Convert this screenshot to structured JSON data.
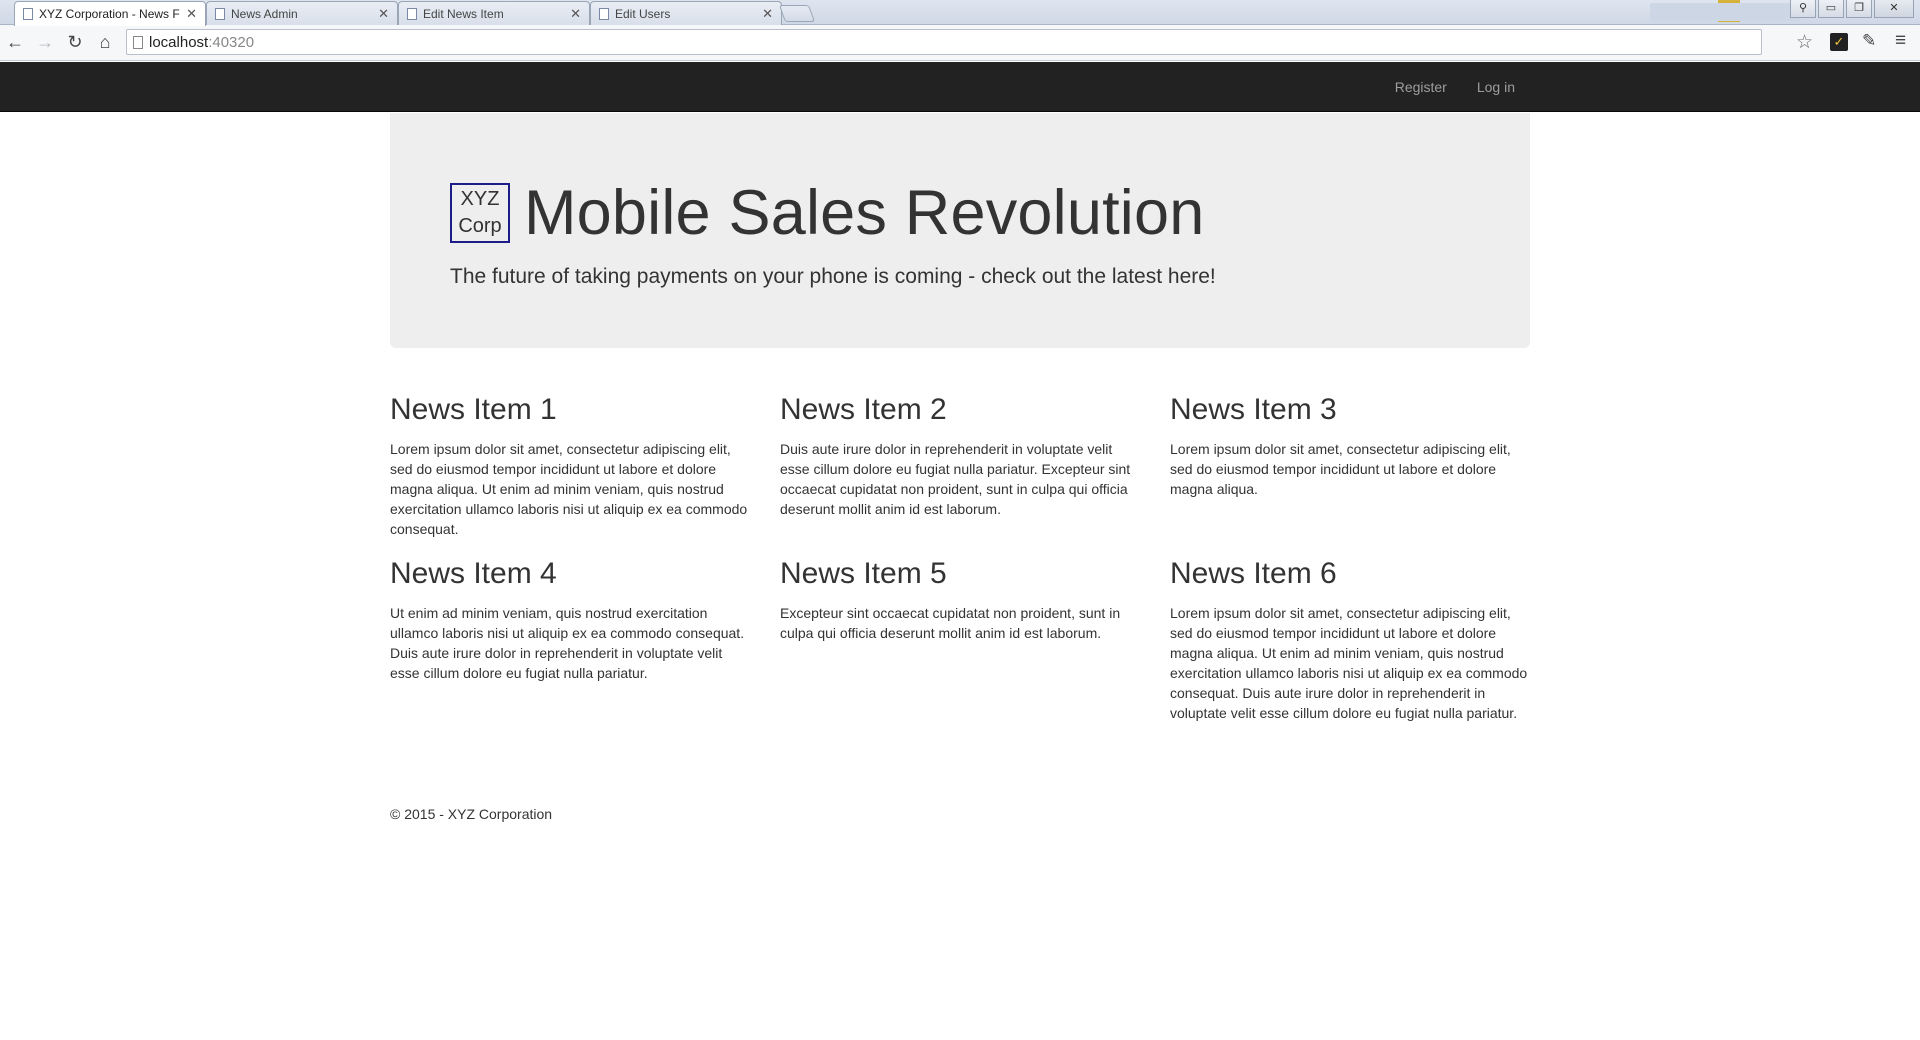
{
  "browser": {
    "tabs": [
      {
        "label": "XYZ Corporation - News F",
        "active": true
      },
      {
        "label": "News Admin",
        "active": false
      },
      {
        "label": "Edit News Item",
        "active": false
      },
      {
        "label": "Edit Users",
        "active": false
      }
    ],
    "url_host": "localhost",
    "url_port": ":40320"
  },
  "navbar": {
    "register_label": "Register",
    "login_label": "Log in"
  },
  "jumbotron": {
    "logo_line1": "XYZ",
    "logo_line2": "Corp",
    "title": "Mobile Sales Revolution",
    "lead": "The future of taking payments on your phone is coming - check out the latest here!"
  },
  "news": [
    {
      "title": "News Item 1",
      "body": "Lorem ipsum dolor sit amet, consectetur adipiscing elit, sed do eiusmod tempor incididunt ut labore et dolore magna aliqua. Ut enim ad minim veniam, quis nostrud exercitation ullamco laboris nisi ut aliquip ex ea commodo consequat."
    },
    {
      "title": "News Item 2",
      "body": "Duis aute irure dolor in reprehenderit in voluptate velit esse cillum dolore eu fugiat nulla pariatur. Excepteur sint occaecat cupidatat non proident, sunt in culpa qui officia deserunt mollit anim id est laborum."
    },
    {
      "title": "News Item 3",
      "body": "Lorem ipsum dolor sit amet, consectetur adipiscing elit, sed do eiusmod tempor incididunt ut labore et dolore magna aliqua."
    },
    {
      "title": "News Item 4",
      "body": "Ut enim ad minim veniam, quis nostrud exercitation ullamco laboris nisi ut aliquip ex ea commodo consequat. Duis aute irure dolor in reprehenderit in voluptate velit esse cillum dolore eu fugiat nulla pariatur."
    },
    {
      "title": "News Item 5",
      "body": "Excepteur sint occaecat cupidatat non proident, sunt in culpa qui officia deserunt mollit anim id est laborum."
    },
    {
      "title": "News Item 6",
      "body": "Lorem ipsum dolor sit amet, consectetur adipiscing elit, sed do eiusmod tempor incididunt ut labore et dolore magna aliqua. Ut enim ad minim veniam, quis nostrud exercitation ullamco laboris nisi ut aliquip ex ea commodo consequat. Duis aute irure dolor in reprehenderit in voluptate velit esse cillum dolore eu fugiat nulla pariatur."
    }
  ],
  "footer": {
    "text": "© 2015 - XYZ Corporation"
  },
  "colors": {
    "navbar_bg": "#222222",
    "jumbotron_bg": "#eeeeee",
    "logo_border": "#1d1d8a"
  }
}
